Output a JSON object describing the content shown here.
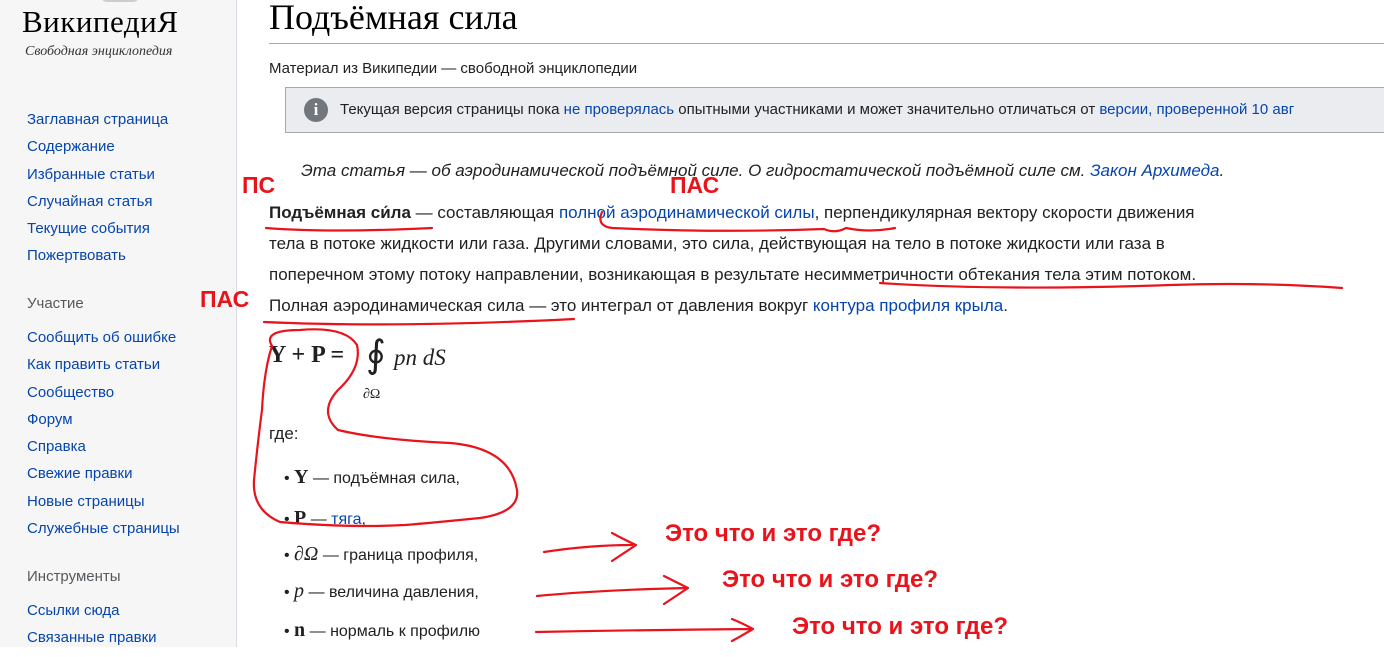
{
  "sidebar": {
    "logo_title": "ВикипедиЯ",
    "logo_subtitle": "Свободная энциклопедия",
    "nav_main": [
      "Заглавная страница",
      "Содержание",
      "Избранные статьи",
      "Случайная статья",
      "Текущие события",
      "Пожертвовать"
    ],
    "participation_heading": "Участие",
    "nav_participation": [
      "Сообщить об ошибке",
      "Как править статьи",
      "Сообщество",
      "Форум",
      "Справка",
      "Свежие правки",
      "Новые страницы",
      "Служебные страницы"
    ],
    "tools_heading": "Инструменты",
    "nav_tools": [
      "Ссылки сюда",
      "Связанные правки"
    ]
  },
  "article": {
    "title": "Подъёмная сила",
    "site_sub": "Материал из Википедии — свободной энциклопедии",
    "notice": {
      "icon": "info-icon",
      "text_before": "Текущая версия страницы пока ",
      "link_unchecked": "не проверялась",
      "text_middle": " опытными участниками и может значительно отличаться от ",
      "link_version": "версии, проверенной 10 авг"
    },
    "hatnote": {
      "text": "Эта статья — об аэродинамической подъёмной силе. О  гидростатической подъёмной силе см. ",
      "link": "Закон Архимеда",
      "end": "."
    },
    "para": {
      "term_bold": "Подъёмная си́ла",
      "t1": " — составляющая ",
      "link_full_force": "полной аэродинамической силы",
      "t2": ", перпендикулярная вектору скорости движения",
      "line2": "тела в потоке жидкости или газа. Другими словами, это сила, действующая на тело в потоке жидкости или газа в",
      "line3": "поперечном этому потоку направлении, возникающая в результате несимметричности обтекания тела этим потоком.",
      "line4_a": "Полная аэродинамическая сила — это интеграл от давления вокруг ",
      "link_contour": "контура профиля крыла",
      "line4_end": "."
    },
    "formula": {
      "lhs": "Y + P =",
      "integral": "∮",
      "rhs": "pn dS",
      "sub": "∂Ω"
    },
    "where": "где:",
    "items": [
      {
        "sym": "Y",
        "text": " — подъёмная сила,"
      },
      {
        "sym": "P",
        "text": " — ",
        "link": "тяга",
        "end": ","
      },
      {
        "sym": "∂Ω",
        "text": " — граница профиля,"
      },
      {
        "sym": "p",
        "text": " — величина давления,"
      },
      {
        "sym": "n",
        "text": " — нормаль к профилю"
      }
    ]
  },
  "annotations": {
    "ps": "ПС",
    "pas_top": "ПАС",
    "pas_left": "ПАС",
    "question": "Это что и это где?",
    "color": "#e8131b"
  }
}
